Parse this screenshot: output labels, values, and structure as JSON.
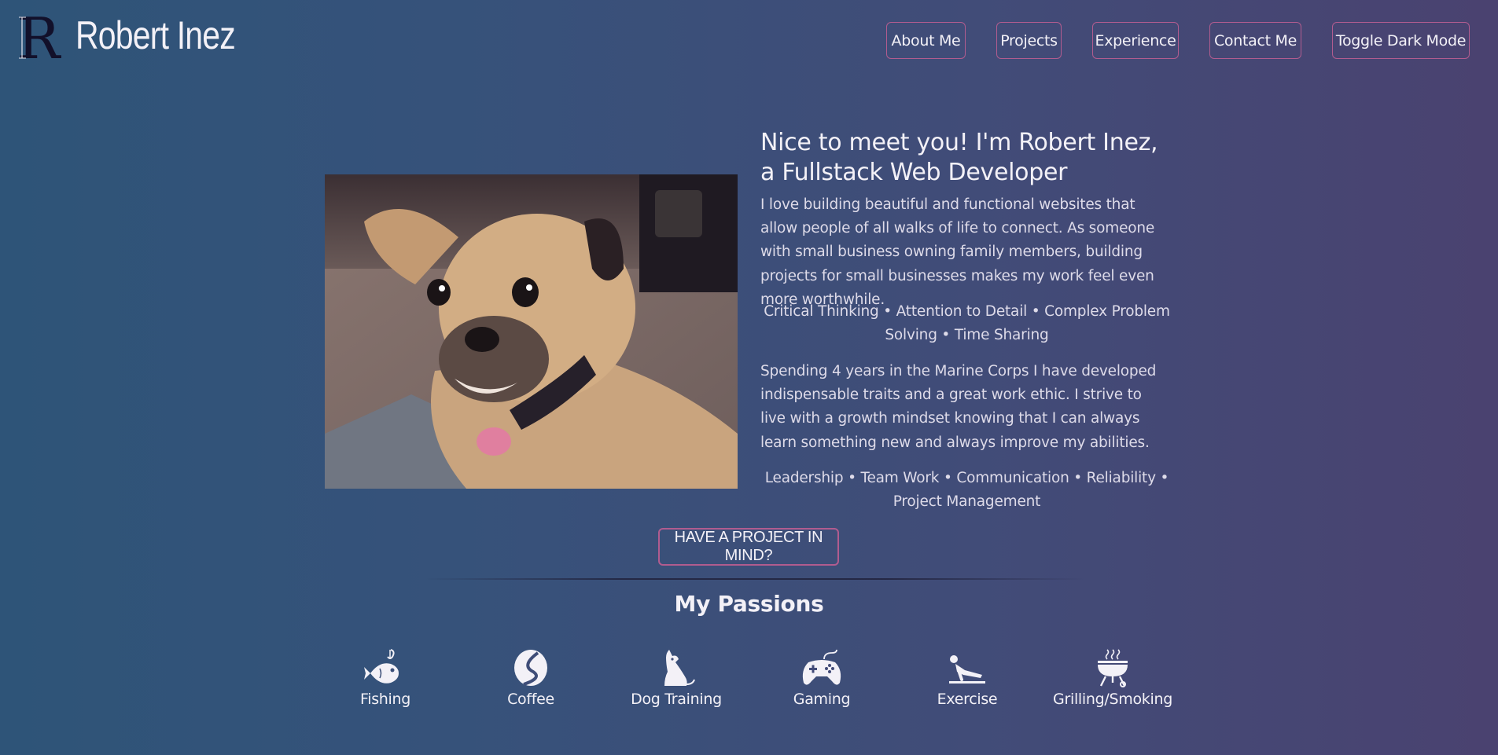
{
  "header": {
    "logo_letter": "R",
    "site_name": "Robert Inez"
  },
  "nav": {
    "items": [
      "About Me",
      "Projects",
      "Experience",
      "Contact Me",
      "Toggle Dark Mode"
    ]
  },
  "hero": {
    "title": "Nice to meet you! I'm Robert Inez, a Fullstack Web Developer",
    "intro": "I love building beautiful and functional websites that allow people of all walks of life to connect. As someone with small business owning family members, building projects for small businesses makes my work feel even more worthwhile.",
    "skills_1": "Critical Thinking • Attention to  Detail • Complex  Problem Solving • Time Sharing",
    "military": "Spending 4 years in the  Marine Corps  I have developed indispensable traits and a great work ethic.  I strive to live with a growth mindset knowing that  I can always learn something new and always improve my abilities.",
    "skills_2": "Leadership • Team Work • Communication •  Reliability • Project Management",
    "cta_label": "HAVE A PROJECT IN MIND?"
  },
  "passions": {
    "title": "My Passions",
    "items": [
      {
        "label": "Fishing",
        "icon": "fishing-icon"
      },
      {
        "label": "Coffee",
        "icon": "coffee-bean-icon"
      },
      {
        "label": "Dog Training",
        "icon": "dog-icon"
      },
      {
        "label": "Gaming",
        "icon": "gamepad-icon"
      },
      {
        "label": "Exercise",
        "icon": "pushup-icon"
      },
      {
        "label": "Grilling/Smoking",
        "icon": "grill-icon"
      }
    ]
  },
  "colors": {
    "accent_border": "#b15c8f",
    "bg_left": "#2e5478",
    "bg_right": "#4a4270"
  }
}
